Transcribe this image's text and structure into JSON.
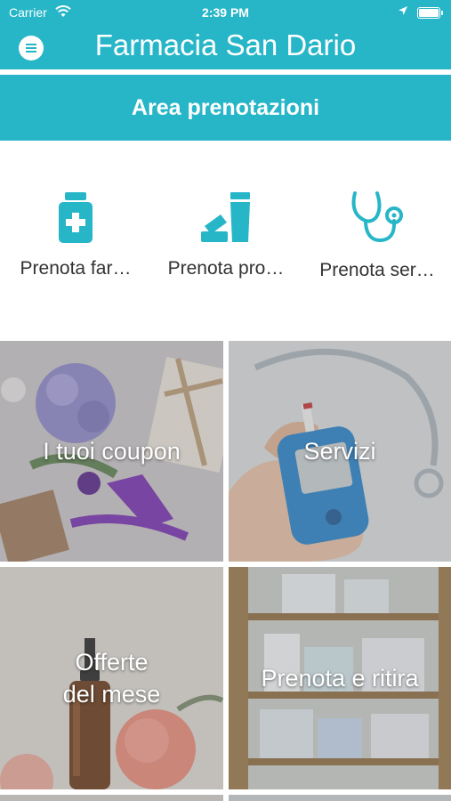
{
  "status_bar": {
    "carrier": "Carrier",
    "time": "2:39 PM"
  },
  "header": {
    "title": "Farmacia San Dario"
  },
  "section": {
    "title": "Area prenotazioni"
  },
  "shortcuts": [
    {
      "label": "Prenota far…",
      "icon": "medicine-bottle-icon"
    },
    {
      "label": "Prenota pro…",
      "icon": "cosmetics-icon"
    },
    {
      "label": "Prenota ser…",
      "icon": "stethoscope-icon"
    }
  ],
  "tiles": [
    {
      "title": "I tuoi coupon"
    },
    {
      "title": "Servizi"
    },
    {
      "title_line1": "Offerte",
      "title_line2": "del mese"
    },
    {
      "title": "Prenota e ritira"
    }
  ],
  "colors": {
    "accent": "#27b6c8",
    "text": "#333333"
  }
}
